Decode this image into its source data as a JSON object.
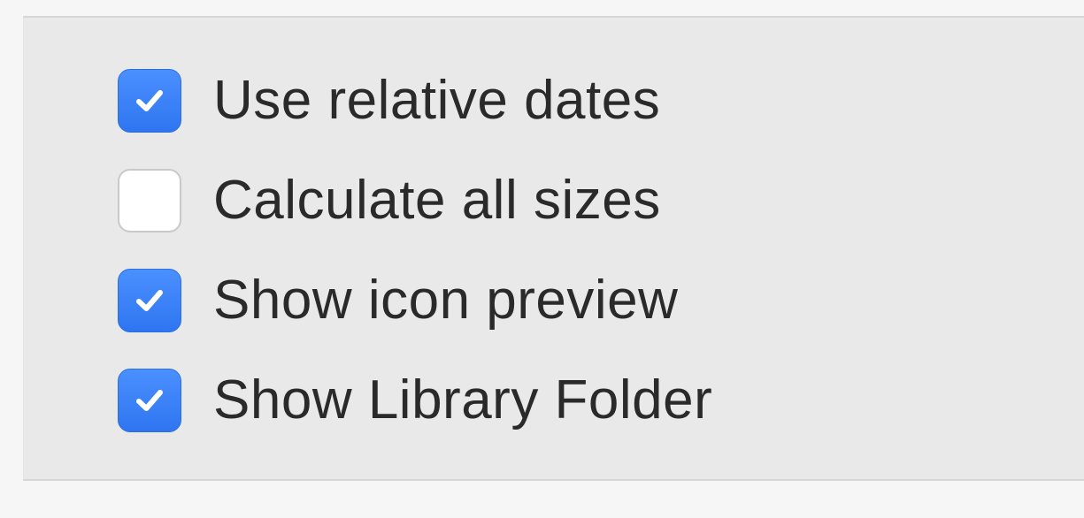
{
  "options": [
    {
      "label": "Use relative dates",
      "checked": true
    },
    {
      "label": "Calculate all sizes",
      "checked": false
    },
    {
      "label": "Show icon preview",
      "checked": true
    },
    {
      "label": "Show Library Folder",
      "checked": true
    }
  ],
  "colors": {
    "panel_background": "#e9e9e9",
    "checkbox_checked": "#3b82f6",
    "checkbox_unchecked": "#ffffff",
    "text": "#2a2a2a"
  }
}
